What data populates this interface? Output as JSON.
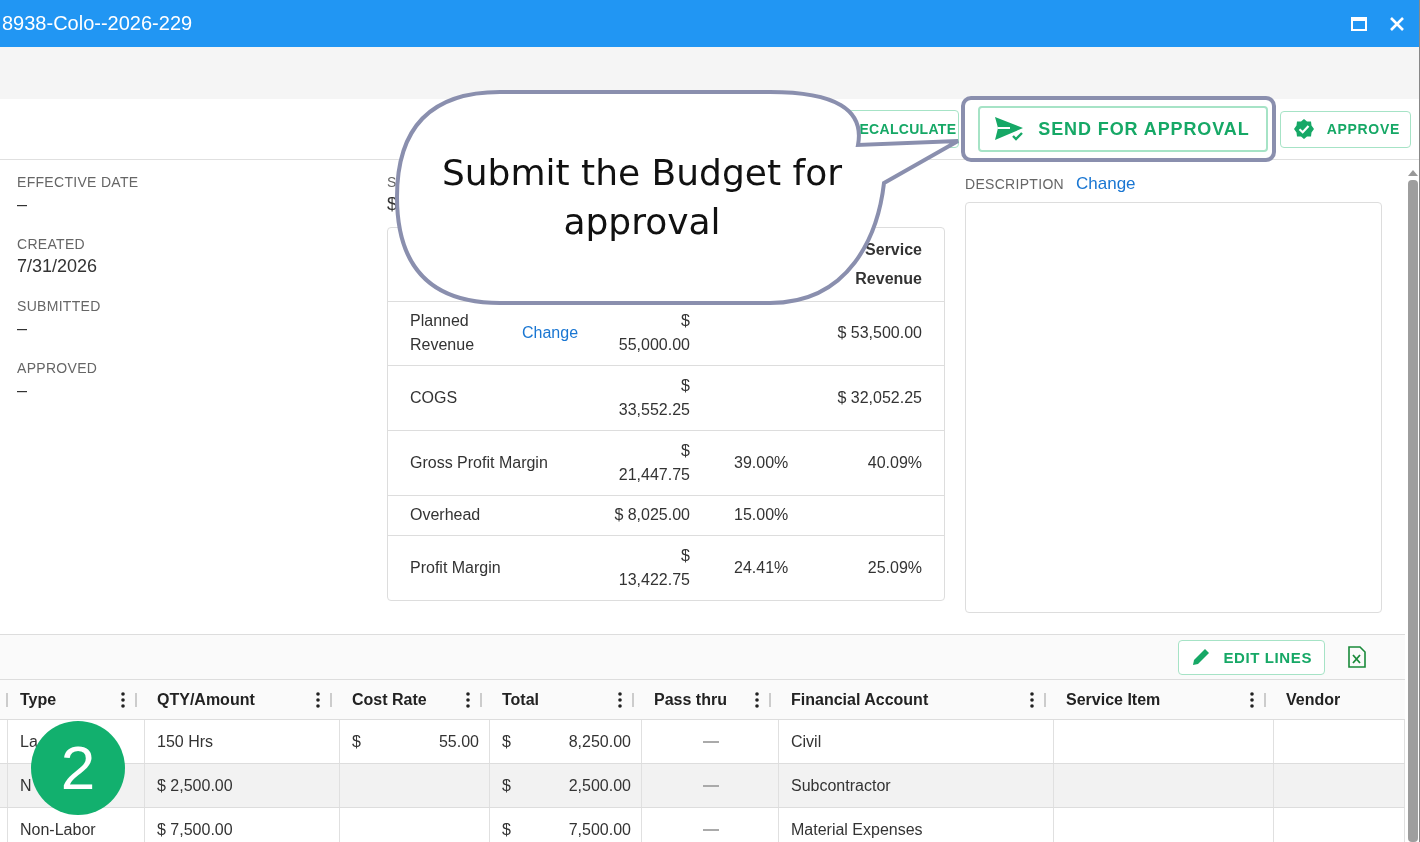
{
  "window": {
    "title": "8938-Colo--2026-229"
  },
  "actions": [
    {
      "kind": "recalculate",
      "label": "ECALCULATE",
      "highlighted": false
    },
    {
      "kind": "send",
      "label": "SEND FOR APPROVAL",
      "highlighted": true
    },
    {
      "kind": "approve",
      "label": "APPROVE",
      "highlighted": false
    }
  ],
  "details": [
    {
      "label": "EFFECTIVE DATE",
      "value": "–"
    },
    {
      "label": "CREATED",
      "value": "7/31/2026"
    },
    {
      "label": "SUBMITTED",
      "value": "–"
    },
    {
      "label": "APPROVED",
      "value": "–"
    }
  ],
  "summary_field": {
    "label": "S",
    "value": "$"
  },
  "summary_table": {
    "column_4": "Service Revenue",
    "rows": [
      {
        "label": "Planned Revenue",
        "link": "Change",
        "amount": "$ 55,000.00",
        "service_revenue": "$ 53,500.00"
      },
      {
        "label": "COGS",
        "amount": "$ 33,552.25",
        "service_revenue": "$ 32,052.25"
      },
      {
        "label": "Gross Profit Margin",
        "amount": "$ 21,447.75",
        "percent": "39.00%",
        "service_revenue": "40.09%"
      },
      {
        "label": "Overhead",
        "amount": "$ 8,025.00",
        "percent": "15.00%"
      },
      {
        "label": "Profit Margin",
        "amount": "$ 13,422.75",
        "percent": "24.41%",
        "service_revenue": "25.09%"
      }
    ]
  },
  "description": {
    "label": "DESCRIPTION",
    "link": "Change"
  },
  "grid": {
    "edit_button": "EDIT LINES",
    "columns": [
      "Type",
      "QTY/Amount",
      "Cost Rate",
      "Total",
      "Pass thru",
      "Financial Account",
      "Service Item",
      "Vendor"
    ],
    "rows": [
      {
        "selected": false,
        "type": "La",
        "qty": "150 Hrs",
        "cost_rate": {
          "currency": "$",
          "amount": "55.00"
        },
        "total": {
          "currency": "$",
          "amount": "8,250.00"
        },
        "pass_thru": false,
        "financial_account": "Civil"
      },
      {
        "selected": true,
        "type": "N",
        "qty": "$ 2,500.00",
        "total": {
          "currency": "$",
          "amount": "2,500.00"
        },
        "pass_thru": false,
        "financial_account": "Subcontractor"
      },
      {
        "selected": false,
        "type": "Non-Labor",
        "qty": "$ 7,500.00",
        "total": {
          "currency": "$",
          "amount": "7,500.00"
        },
        "pass_thru": false,
        "financial_account": "Material Expenses"
      }
    ]
  },
  "callout": {
    "text": "Submit the Budget for approval"
  },
  "step_badge": "2"
}
